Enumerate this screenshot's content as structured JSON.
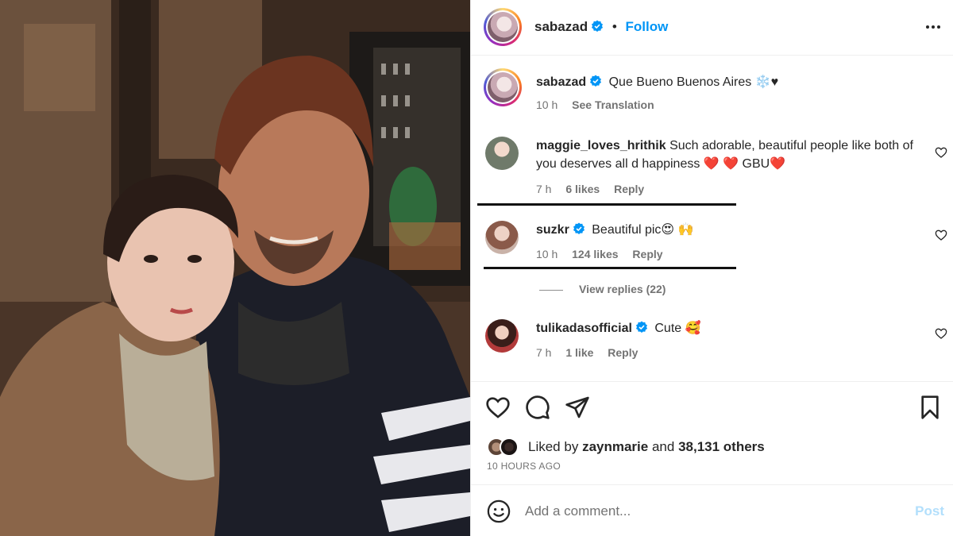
{
  "post": {
    "author": "sabazad",
    "follow_label": "Follow",
    "separator": "•"
  },
  "caption": {
    "author": "sabazad",
    "text": "Que Bueno Buenos Aires ❄️♥",
    "time": "10 h",
    "see_translation": "See Translation"
  },
  "comments": [
    {
      "user": "maggie_loves_hrithik",
      "verified": false,
      "text": "Such adorable, beautiful people like both of you deserves all d happiness ❤️ ❤️  GBU❤️",
      "time": "7 h",
      "likes": "6 likes",
      "reply": "Reply"
    },
    {
      "user": "suzkr",
      "verified": true,
      "text": "Beautiful pic😍 🙌",
      "time": "10 h",
      "likes": "124 likes",
      "reply": "Reply",
      "view_replies": "View replies (22)"
    },
    {
      "user": "tulikadasofficial",
      "verified": true,
      "text": "Cute 🥰",
      "time": "7 h",
      "likes": "1 like",
      "reply": "Reply"
    }
  ],
  "likes": {
    "prefix": "Liked by",
    "user": "zaynmarie",
    "middle": "and",
    "count": "38,131 others",
    "time_ago": "10 HOURS AGO"
  },
  "composer": {
    "placeholder": "Add a comment...",
    "post_label": "Post"
  },
  "colors": {
    "accent": "#0095f6",
    "verified": "#0095f6",
    "heart": "#ed4956",
    "post_disabled": "#b2dffc"
  },
  "icons": {
    "more": "more-horizontal-icon",
    "like": "heart-icon",
    "comment": "comment-icon",
    "share": "send-icon",
    "save": "bookmark-icon",
    "emoji": "emoji-icon"
  }
}
